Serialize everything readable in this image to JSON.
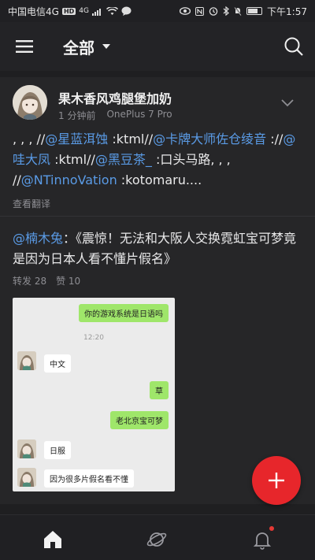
{
  "status_bar": {
    "carrier": "中国电信4G",
    "net_badge": "HD",
    "sub_net": "4G",
    "time": "下午1:57",
    "battery_level": 0.78
  },
  "header": {
    "title": "全部",
    "menu_icon": "menu-icon",
    "search_icon": "search-icon"
  },
  "post": {
    "author": "果木香风鸡腿堡加奶",
    "time": "1 分钟前",
    "device": "OnePlus 7 Pro",
    "text_parts": [
      {
        "t": ", , , //",
        "link": false
      },
      {
        "t": "@星蓝洱蚀",
        "link": true
      },
      {
        "t": " :ktml//",
        "link": false
      },
      {
        "t": "@卡牌大师佐仓绫音",
        "link": true
      },
      {
        "t": " ://",
        "link": false
      },
      {
        "t": "@哇大凤",
        "link": true
      },
      {
        "t": " :ktml//",
        "link": false
      },
      {
        "t": "@黑豆茶_",
        "link": true
      },
      {
        "t": " :口头马路, , , //",
        "link": false
      },
      {
        "t": "@NTinnoVation",
        "link": true
      },
      {
        "t": " :kotomaru....",
        "link": false
      }
    ],
    "translate": "查看翻译",
    "repost": {
      "mention": "@楠木兔",
      "text": "：《震惊！无法和大阪人交换霓虹宝可梦竟是因为日本人看不懂片假名》",
      "forward_label": "转发 28",
      "like_label": "赞 10"
    },
    "chat": {
      "messages": [
        {
          "side": "right",
          "text": "你的游戏系统是日语吗"
        },
        {
          "side": "center",
          "text": "12:20"
        },
        {
          "side": "left",
          "text": "中文"
        },
        {
          "side": "right",
          "text": "草"
        },
        {
          "side": "right",
          "text": "老北京宝可梦"
        },
        {
          "side": "left",
          "text": "日服"
        },
        {
          "side": "left",
          "text": "因为很多片假名看不懂"
        }
      ]
    }
  },
  "fab": {
    "icon": "plus-icon"
  },
  "bottom_nav": {
    "items": [
      {
        "icon": "home-icon",
        "active": true
      },
      {
        "icon": "planet-icon",
        "active": false
      },
      {
        "icon": "bell-icon",
        "active": false,
        "badge": true
      }
    ]
  },
  "colors": {
    "link": "#5a9be6",
    "fab": "#e7262b",
    "bubble_green": "#9fe66a"
  }
}
